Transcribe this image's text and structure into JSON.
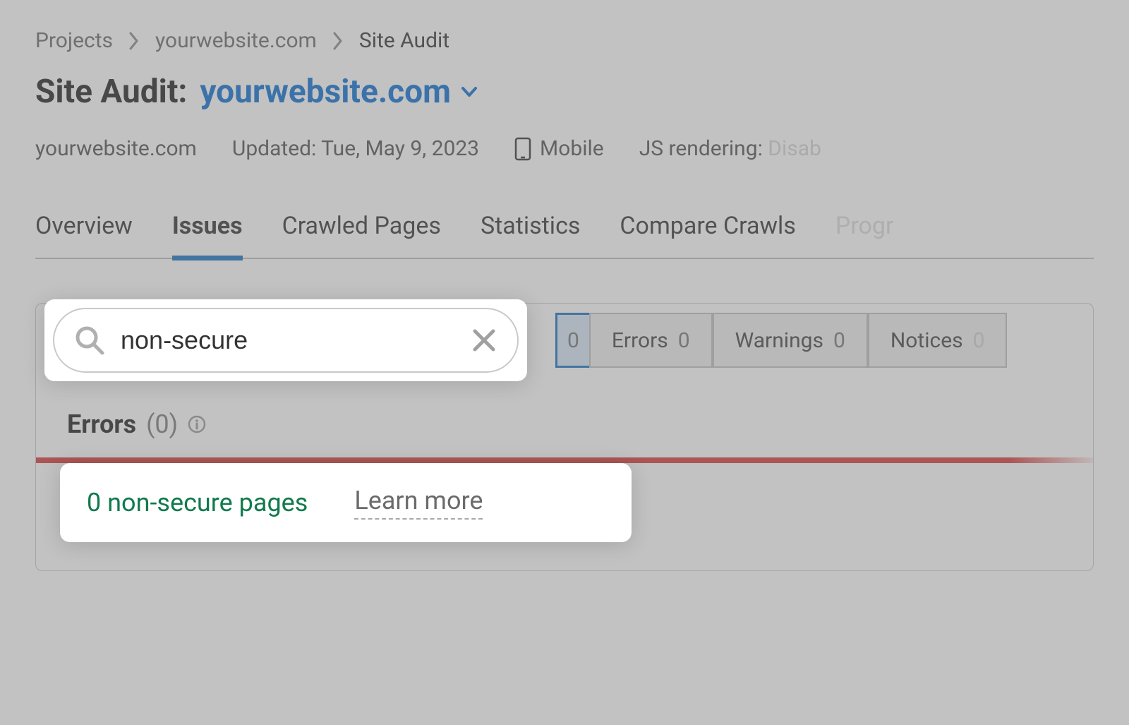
{
  "breadcrumb": {
    "items": [
      "Projects",
      "yourwebsite.com",
      "Site Audit"
    ]
  },
  "title": {
    "label": "Site Audit:",
    "domain": "yourwebsite.com"
  },
  "meta": {
    "domain": "yourwebsite.com",
    "updated": "Updated: Tue, May 9, 2023",
    "device": "Mobile",
    "js_label": "JS rendering:",
    "js_value": "Disab"
  },
  "tabs": [
    "Overview",
    "Issues",
    "Crawled Pages",
    "Statistics",
    "Compare Crawls",
    "Progr"
  ],
  "search": {
    "value": "non-secure"
  },
  "filters": {
    "all_partial": "0",
    "errors_label": "Errors",
    "errors_count": "0",
    "warnings_label": "Warnings",
    "warnings_count": "0",
    "notices_label": "Notices",
    "notices_count": "0"
  },
  "errors_section": {
    "label": "Errors",
    "count": "(0)"
  },
  "result": {
    "text": "0 non-secure pages",
    "learn_more": "Learn more"
  }
}
